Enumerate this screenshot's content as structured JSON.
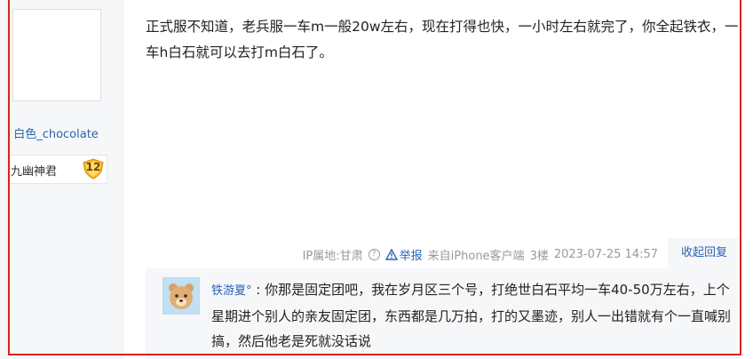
{
  "author": {
    "username": "白色_chocolate",
    "badge_name": "九幽神君",
    "badge_level": "12"
  },
  "post": {
    "content": "正式服不知道，老兵服一车m一般20w左右，现在打得也快，一小时左右就完了，你全起铁衣，一车h白石就可以去打m白石了。",
    "ip_location": "IP属地:甘肃",
    "report_label": "举报",
    "client": "来自iPhone客户端",
    "floor": "3楼",
    "timestamp": "2023-07-25 14:57",
    "collapse_label": "收起回复"
  },
  "reply": {
    "username": "铁游夏°",
    "separator": ":",
    "text": "你那是固定团吧，我在岁月区三个号，打绝世白石平均一车40-50万左右，上个星期进个别人的亲友固定团，东西都是几万拍，打的又墨迹，别人一出错就有个一直喊别搞，然后他老是死就没话说"
  },
  "icons": {
    "help": "question-circle-icon",
    "report": "warning-triangle-icon",
    "level": "shield-badge-icon",
    "reply_avatar": "bear-avatar-icon"
  },
  "colors": {
    "link": "#2d64b3",
    "highlight_border": "#e02020",
    "badge_gold": "#f5b323"
  }
}
